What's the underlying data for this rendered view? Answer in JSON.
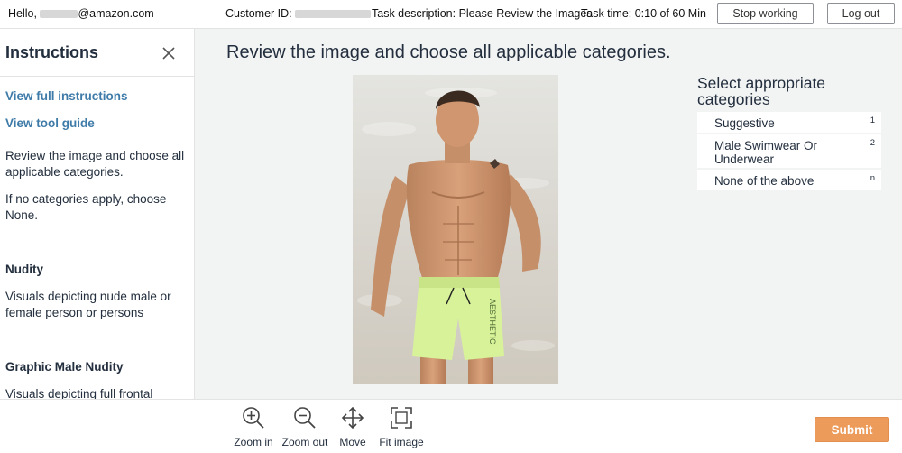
{
  "header": {
    "greeting_prefix": "Hello,",
    "email_suffix": "@amazon.com",
    "customer_id_label": "Customer ID:",
    "task_description": "Task description: Please Review the Images",
    "task_time": "Task time: 0:10 of 60 Min",
    "stop_working_label": "Stop working",
    "log_out_label": "Log out"
  },
  "instructions": {
    "title": "Instructions",
    "view_full_label": "View full instructions",
    "view_tool_guide_label": "View tool guide",
    "paragraph_1": "Review the image and choose all applicable categories.",
    "paragraph_2": "If no categories apply, choose None.",
    "sections": [
      {
        "heading": "Nudity",
        "body": "Visuals depicting nude male or female person or persons"
      },
      {
        "heading": "Graphic Male Nudity",
        "body": "Visuals depicting full frontal"
      }
    ]
  },
  "main": {
    "title": "Review the image and choose all applicable categories."
  },
  "categories": {
    "title": "Select appropriate categories",
    "items": [
      {
        "label": "Suggestive",
        "key": "1"
      },
      {
        "label": "Male Swimwear Or Underwear",
        "key": "2"
      },
      {
        "label": "None of the above",
        "key": "n"
      }
    ]
  },
  "toolbar": {
    "zoom_in_label": "Zoom in",
    "zoom_out_label": "Zoom out",
    "move_label": "Move",
    "fit_image_label": "Fit image",
    "submit_label": "Submit"
  },
  "colors": {
    "link": "#3f7ba8",
    "submit": "#ec9b5b",
    "canvas_bg": "#f2f3f3",
    "text": "#232f3e"
  },
  "icons": [
    "close-icon",
    "zoom-in-icon",
    "zoom-out-icon",
    "move-icon",
    "fit-image-icon"
  ]
}
